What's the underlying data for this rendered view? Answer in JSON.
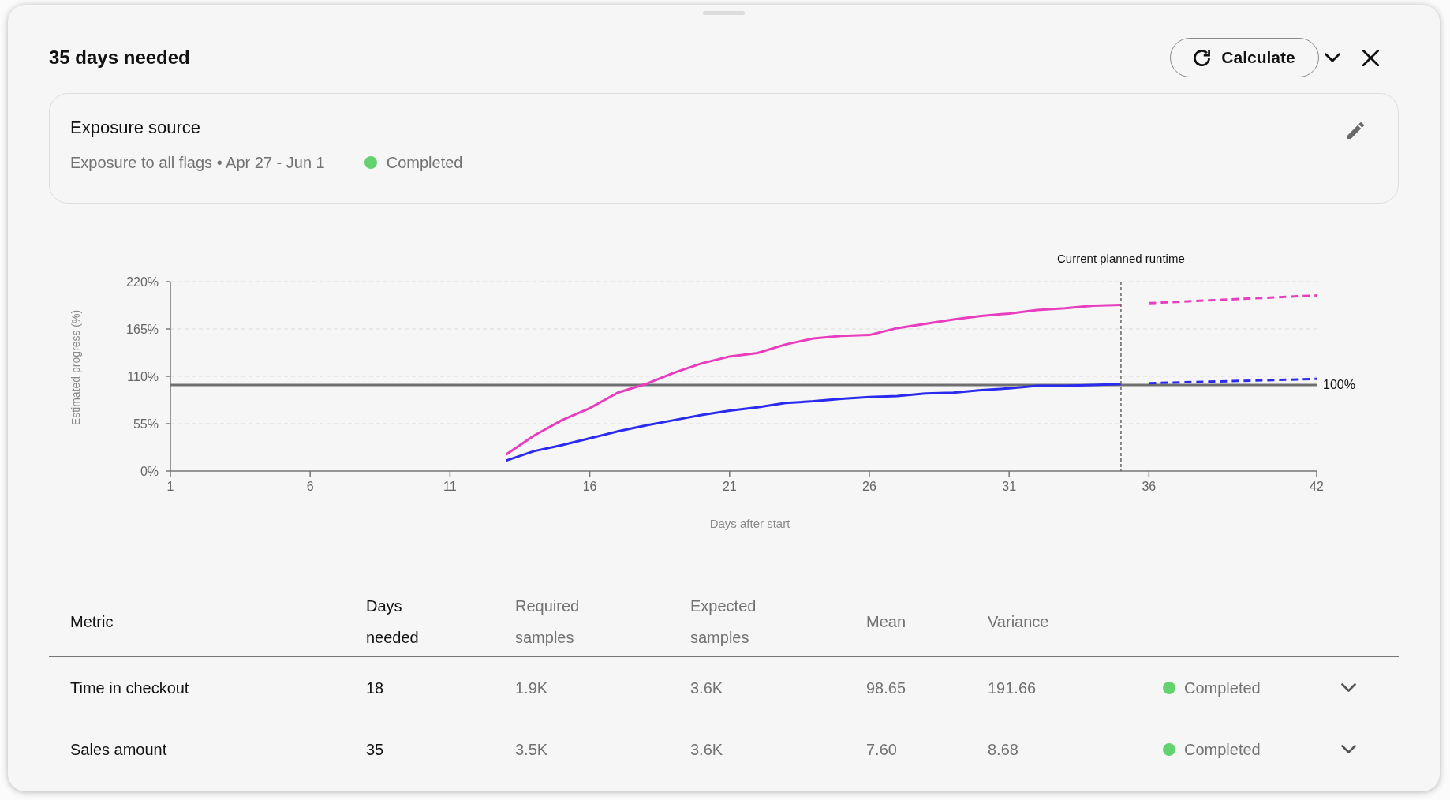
{
  "header": {
    "title": "35 days needed",
    "calculate_button": {
      "label": "Calculate"
    }
  },
  "exposure_source": {
    "title": "Exposure source",
    "description": "Exposure to all flags • Apr 27 - Jun 1",
    "status": {
      "label": "Completed",
      "color": "#64d26f"
    }
  },
  "chart": {
    "chart_data": {
      "type": "line",
      "xlabel": "Days after start",
      "ylabel": "Estimated progress (%)",
      "x": [
        13,
        14,
        15,
        16,
        17,
        18,
        19,
        20,
        21,
        22,
        23,
        24,
        25,
        26,
        27,
        28,
        29,
        30,
        31,
        32,
        33,
        34,
        35,
        36,
        42
      ],
      "series": [
        {
          "color": "#e93dbf",
          "line_style": "solid",
          "values": [
            19,
            41,
            59,
            73,
            91,
            101,
            114,
            125,
            133,
            137,
            147,
            154,
            157,
            158,
            166,
            171,
            176,
            180,
            183,
            187,
            189,
            192,
            193,
            null,
            null
          ]
        },
        {
          "color": "#e93dbf",
          "line_style": "dashed",
          "values": [
            null,
            null,
            null,
            null,
            null,
            null,
            null,
            null,
            null,
            null,
            null,
            null,
            null,
            null,
            null,
            null,
            null,
            null,
            null,
            null,
            null,
            null,
            null,
            195,
            204
          ]
        },
        {
          "color": "#2b2bf0",
          "line_style": "solid",
          "values": [
            12,
            23,
            30,
            38,
            46,
            53,
            59,
            65,
            70,
            74,
            79,
            81,
            84,
            86,
            87,
            90,
            91,
            94,
            96,
            99,
            99,
            100,
            101,
            null,
            null
          ]
        },
        {
          "color": "#2b2bf0",
          "line_style": "dashed",
          "values": [
            null,
            null,
            null,
            null,
            null,
            null,
            null,
            null,
            null,
            null,
            null,
            null,
            null,
            null,
            null,
            null,
            null,
            null,
            null,
            null,
            null,
            null,
            null,
            102,
            107
          ]
        }
      ],
      "xlim": [
        1,
        42
      ],
      "ylim": [
        0,
        220
      ],
      "xticks": [
        1,
        6,
        11,
        16,
        21,
        26,
        31,
        36,
        42
      ],
      "yticks": [
        {
          "value": 0,
          "label": "0%"
        },
        {
          "value": 55,
          "label": "55%"
        },
        {
          "value": 110,
          "label": "110%"
        },
        {
          "value": 165,
          "label": "165%"
        },
        {
          "value": 220,
          "label": "220%"
        }
      ],
      "grid": true,
      "ref_lines": [
        {
          "axis": "y",
          "value": 100,
          "label": "100%",
          "line_style": "solid",
          "color": "#6f6f6f"
        },
        {
          "axis": "x",
          "value": 35,
          "label": "Current planned runtime",
          "line_style": "dashed",
          "color": "#666666"
        }
      ]
    }
  },
  "table": {
    "columns": [
      {
        "label": "Metric",
        "emphasized": true
      },
      {
        "label": "Days needed",
        "emphasized": true
      },
      {
        "label": "Required samples",
        "emphasized": false
      },
      {
        "label": "Expected samples",
        "emphasized": false
      },
      {
        "label": "Mean",
        "emphasized": false
      },
      {
        "label": "Variance",
        "emphasized": false
      }
    ],
    "rows": [
      {
        "cells": [
          "Time in checkout",
          "18",
          "1.9K",
          "3.6K",
          "98.65",
          "191.66"
        ],
        "status": {
          "label": "Completed",
          "color": "#64d26f"
        },
        "expanded": false
      },
      {
        "cells": [
          "Sales amount",
          "35",
          "3.5K",
          "3.6K",
          "7.60",
          "8.68"
        ],
        "status": {
          "label": "Completed",
          "color": "#64d26f"
        },
        "expanded": false
      }
    ]
  }
}
